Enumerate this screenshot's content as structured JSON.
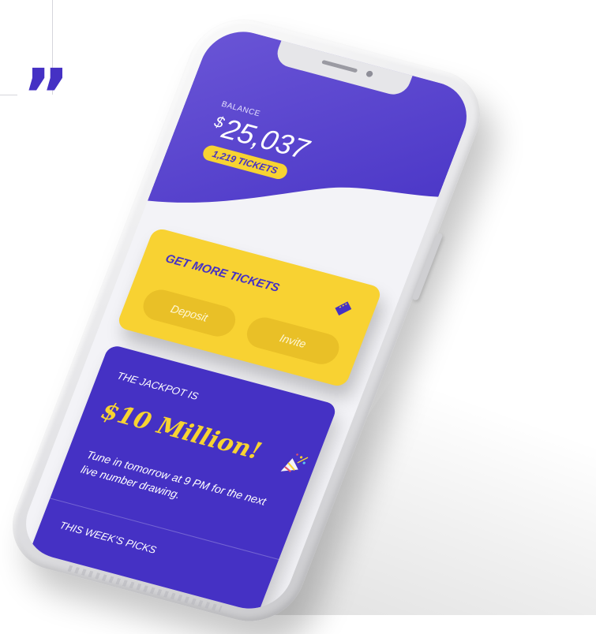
{
  "decoration": {
    "quote_mark": "”",
    "accent_color": "#4531c4"
  },
  "phone": {
    "header": {
      "balance_label": "BALANCE",
      "currency_symbol": "$",
      "balance_amount": "25,037",
      "tickets_count": "1,219 TICKETS"
    },
    "get_tickets_card": {
      "title": "GET MORE TICKETS",
      "icon": "ticket-icon",
      "deposit_label": "Deposit",
      "invite_label": "Invite"
    },
    "jackpot_card": {
      "label": "THE JACKPOT IS",
      "amount": "$10 Million!",
      "icon": "party-popper-icon",
      "description": "Tune in tomorrow at 9 PM for the next live number drawing.",
      "weekly_picks": "THIS WEEK’S PICKS"
    }
  },
  "colors": {
    "primary_purple": "#4531c4",
    "header_purple": "#5a43cc",
    "yellow": "#f8d232",
    "screen_bg": "#f3f3f7"
  }
}
